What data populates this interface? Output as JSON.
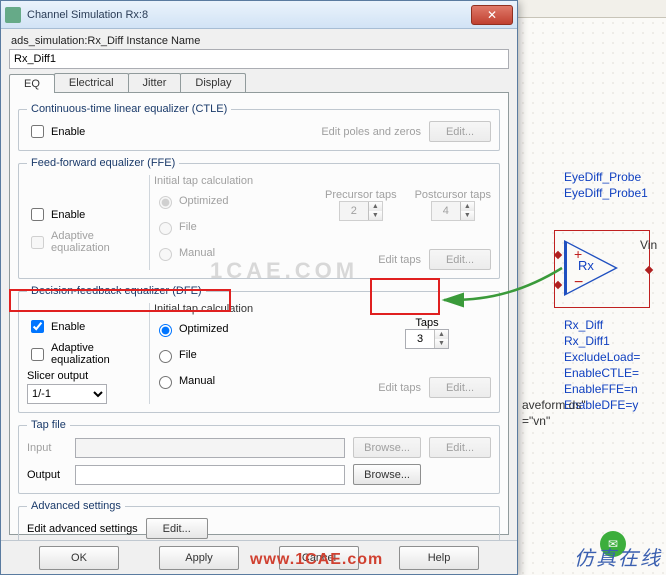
{
  "window": {
    "title": "Channel Simulation Rx:8"
  },
  "instance": {
    "label": "ads_simulation:Rx_Diff Instance Name",
    "value": "Rx_Diff1"
  },
  "tabs": [
    "EQ",
    "Electrical",
    "Jitter",
    "Display"
  ],
  "ctle": {
    "legend": "Continuous-time linear equalizer (CTLE)",
    "enable": "Enable",
    "edit_poles": "Edit poles and zeros",
    "edit": "Edit..."
  },
  "ffe": {
    "legend": "Feed-forward equalizer (FFE)",
    "initial": "Initial tap calculation",
    "optimized": "Optimized",
    "file": "File",
    "manual": "Manual",
    "enable": "Enable",
    "adaptive": "Adaptive equalization",
    "precursor": "Precursor taps",
    "postcursor": "Postcursor taps",
    "preval": "2",
    "postval": "4",
    "edit_taps": "Edit taps",
    "edit": "Edit..."
  },
  "dfe": {
    "legend": "Decision-feedback equalizer (DFE)",
    "initial": "Initial tap calculation",
    "optimized": "Optimized",
    "file": "File",
    "manual": "Manual",
    "enable": "Enable",
    "adaptive": "Adaptive equalization",
    "slicer_label": "Slicer output",
    "slicer_value": "1/-1",
    "taps_label": "Taps",
    "taps_value": "3",
    "edit_taps": "Edit taps",
    "edit": "Edit..."
  },
  "tapfile": {
    "legend": "Tap file",
    "input": "Input",
    "output": "Output",
    "browse": "Browse...",
    "edit": "Edit..."
  },
  "advanced": {
    "legend": "Advanced settings",
    "label": "Edit advanced settings",
    "edit": "Edit..."
  },
  "buttons": {
    "ok": "OK",
    "apply": "Apply",
    "cancel": "Cancel",
    "help": "Help"
  },
  "schematic": {
    "probe1": "EyeDiff_Probe",
    "probe2": "EyeDiff_Probe1",
    "rx": "Rx",
    "vin": "Vin",
    "p1": "Rx_Diff",
    "p2": "Rx_Diff1",
    "p3": "ExcludeLoad=",
    "p4": "EnableCTLE=",
    "p5": "EnableFFE=n",
    "p6": "EnableDFE=y",
    "wf": "aveform.ds\"",
    "vn": "=\"vn\""
  },
  "watermark": "1CAE.COM",
  "wm_url": "www.1CAE.com",
  "cn": "仿真在线"
}
